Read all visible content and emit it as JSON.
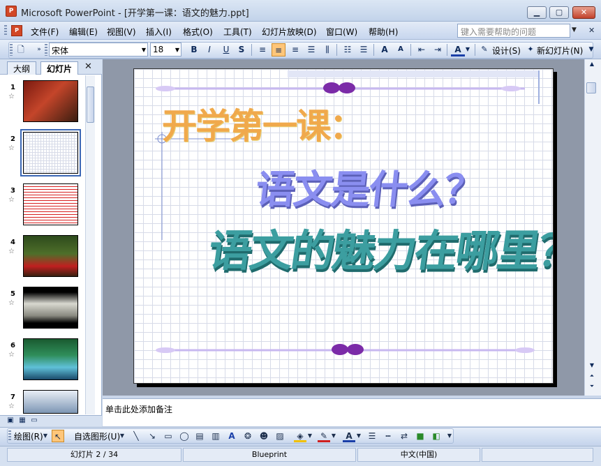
{
  "window": {
    "title": "Microsoft PowerPoint - [开学第一课：语文的魅力.ppt]",
    "min": "▁",
    "max": "▢",
    "close": "✕"
  },
  "menu": {
    "doc_icon": "P",
    "items": [
      "文件(F)",
      "编辑(E)",
      "视图(V)",
      "插入(I)",
      "格式(O)",
      "工具(T)",
      "幻灯片放映(D)",
      "窗口(W)",
      "帮助(H)"
    ],
    "help_placeholder": "键入需要帮助的问题",
    "mdi_close": "✕"
  },
  "format_toolbar": {
    "font": "宋体",
    "size": "18",
    "bold": "B",
    "italic": "I",
    "underline": "U",
    "shadow": "S",
    "grow_font": "A",
    "shrink_font": "A",
    "font_color": "A",
    "design": "设计(S)",
    "new_slide": "新幻灯片(N)"
  },
  "left_pane": {
    "tabs": [
      "大纲",
      "幻灯片"
    ],
    "close": "✕",
    "slides": [
      {
        "num": "1",
        "star": "☆"
      },
      {
        "num": "2",
        "star": "☆"
      },
      {
        "num": "3",
        "star": "☆"
      },
      {
        "num": "4",
        "star": "☆"
      },
      {
        "num": "5",
        "star": "☆"
      },
      {
        "num": "6",
        "star": "☆"
      },
      {
        "num": "7",
        "star": "☆"
      }
    ]
  },
  "slide": {
    "title": "开学第一课：",
    "line1": "语文是什么？",
    "line2": "语文的魅力在哪里？"
  },
  "notes": {
    "placeholder": "单击此处添加备注"
  },
  "draw_toolbar": {
    "draw": "绘图(R)",
    "autoshapes": "自选图形(U)"
  },
  "status": {
    "slide": "幻灯片 2 / 34",
    "template": "Blueprint",
    "language": "中文(中国)"
  },
  "colors": {
    "title_orange": "#f0a94c",
    "line1_purple": "#8a8ef0",
    "line2_teal": "#3c9ea0",
    "selected": "#ffc67a"
  }
}
